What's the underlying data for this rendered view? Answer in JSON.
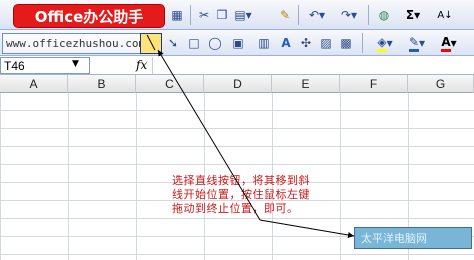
{
  "logo": {
    "text": "Office办公助手"
  },
  "website": {
    "text": "www.officezhushou.com"
  },
  "toolbar": {
    "buttons": [
      {
        "name": "format-painter-icon",
        "glyph": "🖌"
      },
      {
        "name": "cut-icon",
        "glyph": "✂"
      },
      {
        "name": "copy-icon",
        "glyph": "⎘"
      },
      {
        "name": "paste-icon",
        "glyph": "📋"
      },
      {
        "name": "paint-brush-icon",
        "glyph": "✎"
      },
      {
        "name": "undo-icon",
        "glyph": "↶"
      },
      {
        "name": "redo-icon",
        "glyph": "↷"
      },
      {
        "name": "hyperlink-icon",
        "glyph": "🌐"
      },
      {
        "name": "autosum-icon",
        "glyph": "Σ"
      },
      {
        "name": "sort-ascending-icon",
        "glyph": "↓A"
      }
    ]
  },
  "draw_toolbar": {
    "line_button_glyph": "╲",
    "arrow_glyph": "➘",
    "rectangle_glyph": "□",
    "oval_glyph": "◯",
    "fill_color": "#ffff00",
    "line_color": "#1f5fbf",
    "font_color": "#ff0000"
  },
  "formula_bar": {
    "name_box_value": "T46",
    "fx_label": "fx",
    "formula_value": ""
  },
  "columns": [
    "A",
    "B",
    "C",
    "D",
    "E",
    "F",
    "G"
  ],
  "callout": {
    "text": "选择直线按钮，将其移到斜线开始位置，按住鼠标左键拖动到终止位置，即可。"
  },
  "watermark": {
    "text": "太平洋电脑网"
  }
}
